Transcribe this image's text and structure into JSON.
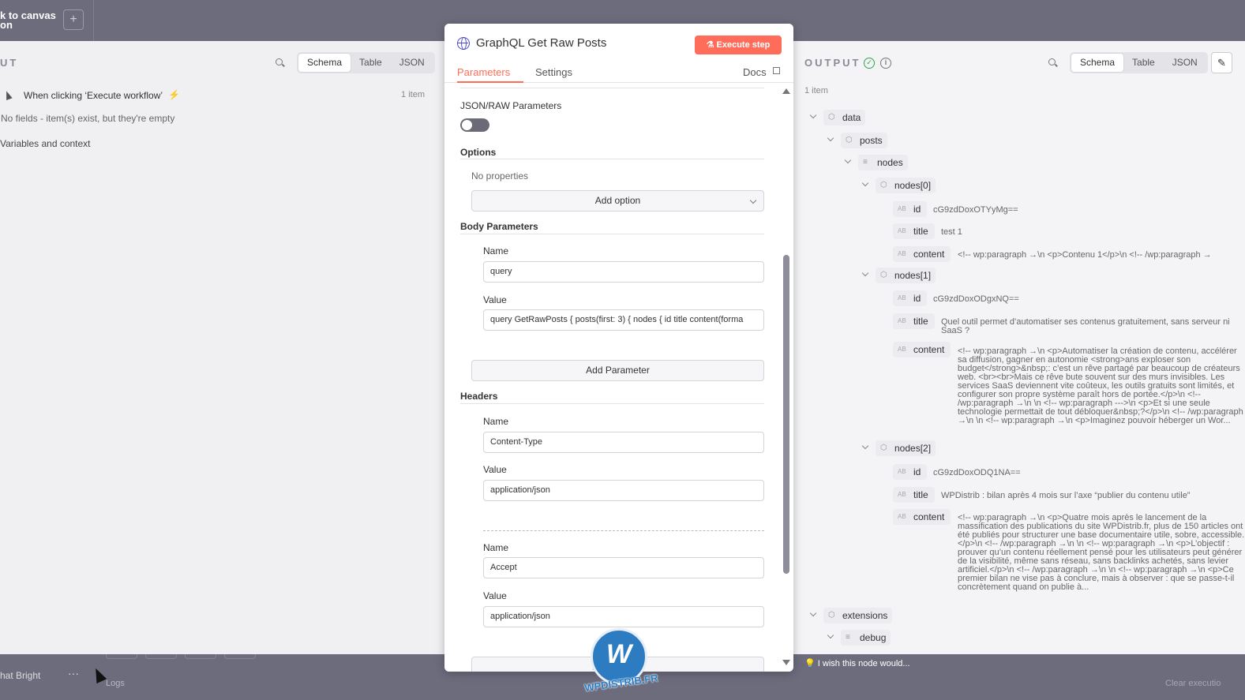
{
  "topbar": {
    "back_label": "k to canvas",
    "back_label_2": "on",
    "add_symbol": "+"
  },
  "input_panel": {
    "heading": "UT",
    "view_tabs": [
      "Schema",
      "Table",
      "JSON"
    ],
    "active_tab": "Schema",
    "trigger": {
      "label": "When clicking ‘Execute workflow’",
      "count": "1 item"
    },
    "empty_message": "No fields - item(s) exist, but they're empty",
    "variables_label": "Variables and context"
  },
  "modal": {
    "title": "GraphQL Get Raw Posts",
    "execute_label": "Execute step",
    "tabs": [
      "Parameters",
      "Settings"
    ],
    "active_tab": "Parameters",
    "docs_label": "Docs",
    "json_raw_label": "JSON/RAW Parameters",
    "json_raw_enabled": false,
    "options_label": "Options",
    "no_properties": "No properties",
    "add_option_label": "Add option",
    "body_params_label": "Body Parameters",
    "body_params": [
      {
        "name_label": "Name",
        "name_value": "query",
        "value_label": "Value",
        "value": "query GetRawPosts { posts(first: 3) { nodes { id title content(forma"
      }
    ],
    "add_parameter_label": "Add Parameter",
    "headers_label": "Headers",
    "headers": [
      {
        "name_label": "Name",
        "name_value": "Content-Type",
        "value_label": "Value",
        "value": "application/json"
      },
      {
        "name_label": "Name",
        "name_value": "Accept",
        "value_label": "Value",
        "value": "application/json"
      }
    ],
    "add_header_label": "Add Header"
  },
  "output_panel": {
    "heading": "OUTPUT",
    "view_tabs": [
      "Schema",
      "Table",
      "JSON"
    ],
    "active_tab": "Schema",
    "count": "1 item",
    "tree": {
      "data": "data",
      "posts": "posts",
      "nodes": "nodes",
      "items": [
        {
          "label": "nodes[0]",
          "id": "cG9zdDoxOTYyMg==",
          "title": "test 1",
          "content": "<!-- wp:paragraph →\\n <p>Contenu 1</p>\\n <!-- /wp:paragraph →"
        },
        {
          "label": "nodes[1]",
          "id": "cG9zdDoxODgxNQ==",
          "title": "Quel outil permet d’automatiser ses contenus gratuitement, sans serveur ni SaaS ?",
          "content": "<!-- wp:paragraph →\\n <p>Automatiser la création de contenu, accélérer sa diffusion, gagner en autonomie <strong>ans exploser son budget</strong>&nbsp;: c’est un rêve partagé par beaucoup de créateurs web. <br><br>Mais ce rêve bute souvent sur des murs invisibles. Les services SaaS deviennent vite coûteux, les outils gratuits sont limités, et configurer son propre système paraît hors de portée.</p>\\n <!-- /wp:paragraph →\\n \\n <!-- wp:paragraph --->\\n <p>Et si une seule technologie permettait de tout débloquer&nbsp;?</p>\\n <!-- /wp:paragraph →\\n \\n <!-- wp:paragraph →\\n <p>Imaginez pouvoir héberger un Wor..."
        },
        {
          "label": "nodes[2]",
          "id": "cG9zdDoxODQ1NA==",
          "title": "WPDistrib : bilan après 4 mois sur l’axe “publier du contenu utile”",
          "content": "<!-- wp:paragraph →\\n <p>Quatre mois après le lancement de la massification des publications du site WPDistrib.fr, plus de 150 articles ont été publiés pour structurer une base documentaire utile, sobre, accessible.</p>\\n <!-- /wp:paragraph →\\n \\n <!-- wp:paragraph →\\n <p>L’objectif : prouver qu’un contenu réellement pensé pour les utilisateurs peut générer de la visibilité, même sans réseau, sans backlinks achetés, sans levier artificiel.</p>\\n <!-- /wp:paragraph →\\n \\n <!-- wp:paragraph →\\n <p>Ce premier bilan ne vise pas à conclure, mais à observer : que se passe-t-il concrètement quand on publie à..."
        }
      ],
      "extensions": "extensions",
      "debug": "debug",
      "key_id": "id",
      "key_title": "title",
      "key_content": "content"
    },
    "wish_label": "I wish this node would..."
  },
  "bottombar": {
    "left_label": "hat Bright",
    "dots": "···",
    "logs_label": "Logs",
    "clear_label": "Clear executio"
  },
  "watermark": {
    "brand": "WPDISTRIB.FR",
    "mark": "W"
  },
  "colors": {
    "accent": "#ff6d5a",
    "success": "#2ea44f",
    "brand_blue": "#2d7cc1"
  }
}
